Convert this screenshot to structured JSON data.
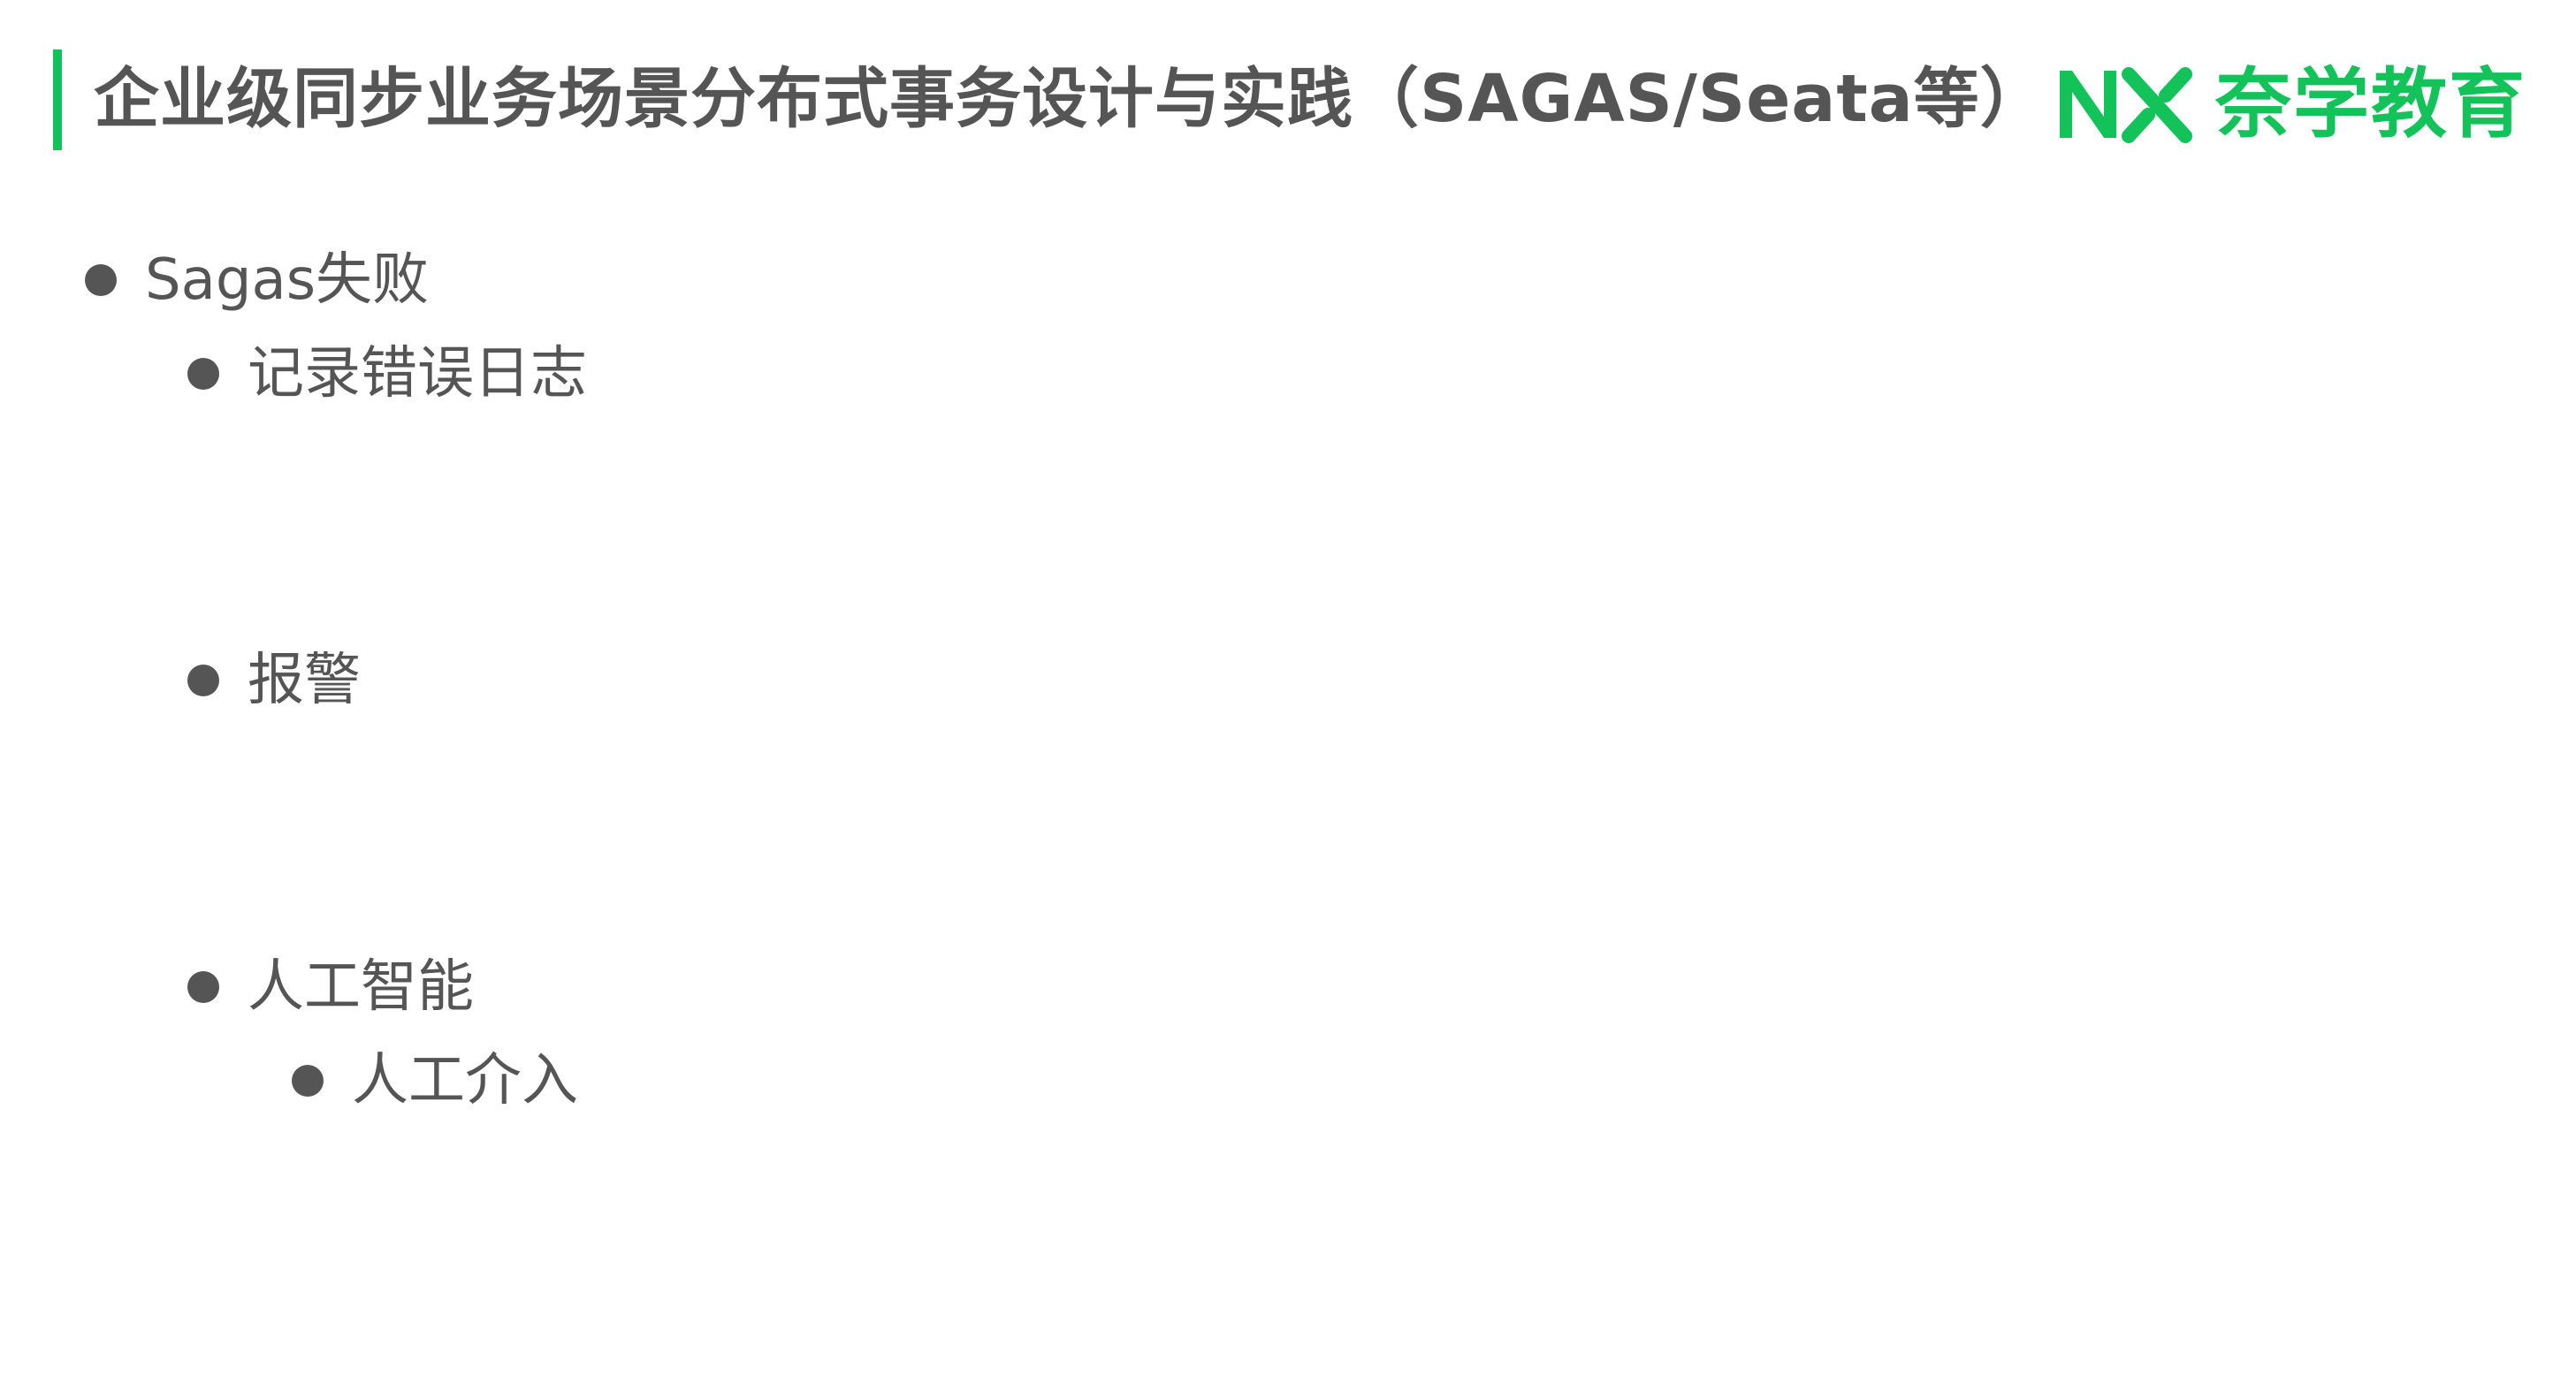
{
  "header": {
    "title": "企业级同步业务场景分布式事务设计与实践（SAGAS/Seata等）",
    "accent_color": "#13c35a",
    "logo": {
      "mark": "NX",
      "text": "奈学教育",
      "color": "#13c35a"
    }
  },
  "content": {
    "items": [
      {
        "level": 1,
        "text": "Sagas失败"
      },
      {
        "level": 2,
        "text": "记录错误日志"
      },
      {
        "level": 2,
        "text": "报警"
      },
      {
        "level": 2,
        "text": "人工智能"
      },
      {
        "level": 3,
        "text": "人工介入"
      }
    ]
  }
}
